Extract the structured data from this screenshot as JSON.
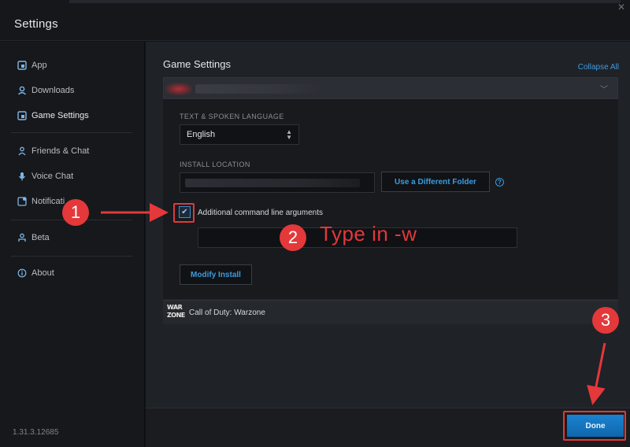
{
  "window": {
    "title": "Settings"
  },
  "sidebar": {
    "items": [
      {
        "label": "App",
        "icon": "app-icon"
      },
      {
        "label": "Downloads",
        "icon": "download-icon"
      },
      {
        "label": "Game Settings",
        "icon": "game-settings-icon"
      },
      {
        "label": "Friends & Chat",
        "icon": "friends-icon"
      },
      {
        "label": "Voice Chat",
        "icon": "microphone-icon"
      },
      {
        "label": "Notificati",
        "icon": "notification-icon"
      },
      {
        "label": "Beta",
        "icon": "beta-icon"
      },
      {
        "label": "About",
        "icon": "info-icon"
      }
    ],
    "version": "1.31.3.12685"
  },
  "main": {
    "section_title": "Game Settings",
    "collapse_label": "Collapse All",
    "language_label": "TEXT & SPOKEN LANGUAGE",
    "language_value": "English",
    "install_label": "INSTALL LOCATION",
    "folder_button": "Use a Different Folder",
    "args_checkbox_label": "Additional command line arguments",
    "args_checked": true,
    "args_value": "",
    "modify_button": "Modify Install",
    "game_row": {
      "logo_line1": "WAR",
      "logo_line2": "ZONE",
      "label": "Call of Duty: Warzone"
    }
  },
  "footer": {
    "done_label": "Done"
  },
  "annotations": {
    "step1": "1",
    "step2": "2",
    "step3": "3",
    "step2_text": "Type in -w",
    "color": "#e4383a"
  }
}
